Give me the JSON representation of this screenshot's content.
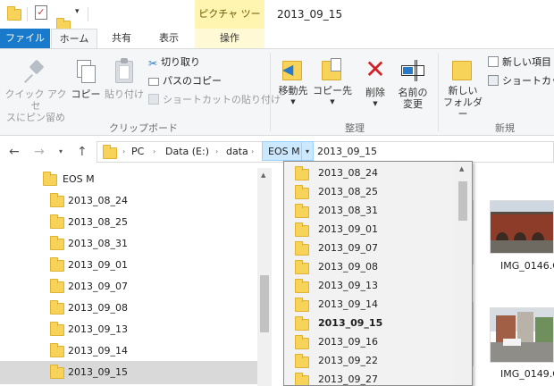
{
  "window": {
    "title": "2013_09_15"
  },
  "context_tab": {
    "label": "ピクチャ ツール"
  },
  "tabs": [
    {
      "label": "ファイル"
    },
    {
      "label": "ホーム"
    },
    {
      "label": "共有"
    },
    {
      "label": "表示"
    },
    {
      "label": "操作"
    }
  ],
  "ribbon": {
    "clipboard": {
      "group_label": "クリップボード",
      "pin_line1": "クイック アクセ",
      "pin_line2": "スにピン留め",
      "copy": "コピー",
      "paste": "貼り付け",
      "cut": "切り取り",
      "copy_path": "パスのコピー",
      "paste_shortcut": "ショートカットの貼り付け"
    },
    "organize": {
      "group_label": "整理",
      "move_to": "移動先",
      "copy_to": "コピー先",
      "delete": "削除",
      "rename_line1": "名前の",
      "rename_line2": "変更"
    },
    "new": {
      "group_label": "新規",
      "new_folder_line1": "新しい",
      "new_folder_line2": "フォルダー",
      "new_item": "新しい項目",
      "shortcut": "ショートカット"
    }
  },
  "address": {
    "crumbs": [
      "PC",
      "Data (E:)",
      "data",
      "EOS M",
      "2013_09_15"
    ]
  },
  "nav_tree": {
    "parent": "EOS M",
    "items": [
      "2013_08_24",
      "2013_08_25",
      "2013_08_31",
      "2013_09_01",
      "2013_09_07",
      "2013_09_08",
      "2013_09_13",
      "2013_09_14",
      "2013_09_15"
    ],
    "selected": "2013_09_15"
  },
  "dropdown": {
    "items": [
      "2013_08_24",
      "2013_08_25",
      "2013_08_31",
      "2013_09_01",
      "2013_09_07",
      "2013_09_08",
      "2013_09_13",
      "2013_09_14",
      "2013_09_15",
      "2013_09_16",
      "2013_09_22",
      "2013_09_27"
    ],
    "current": "2013_09_15"
  },
  "files": [
    {
      "name": "IMG_0146.C"
    },
    {
      "name": "IMG_0149.C"
    }
  ],
  "colors": {
    "file_tab": "#1979ca",
    "context_tab": "#fff4b0",
    "selection": "#cce8ff",
    "delete_red": "#d51f26",
    "folder": "#f7d35a"
  }
}
